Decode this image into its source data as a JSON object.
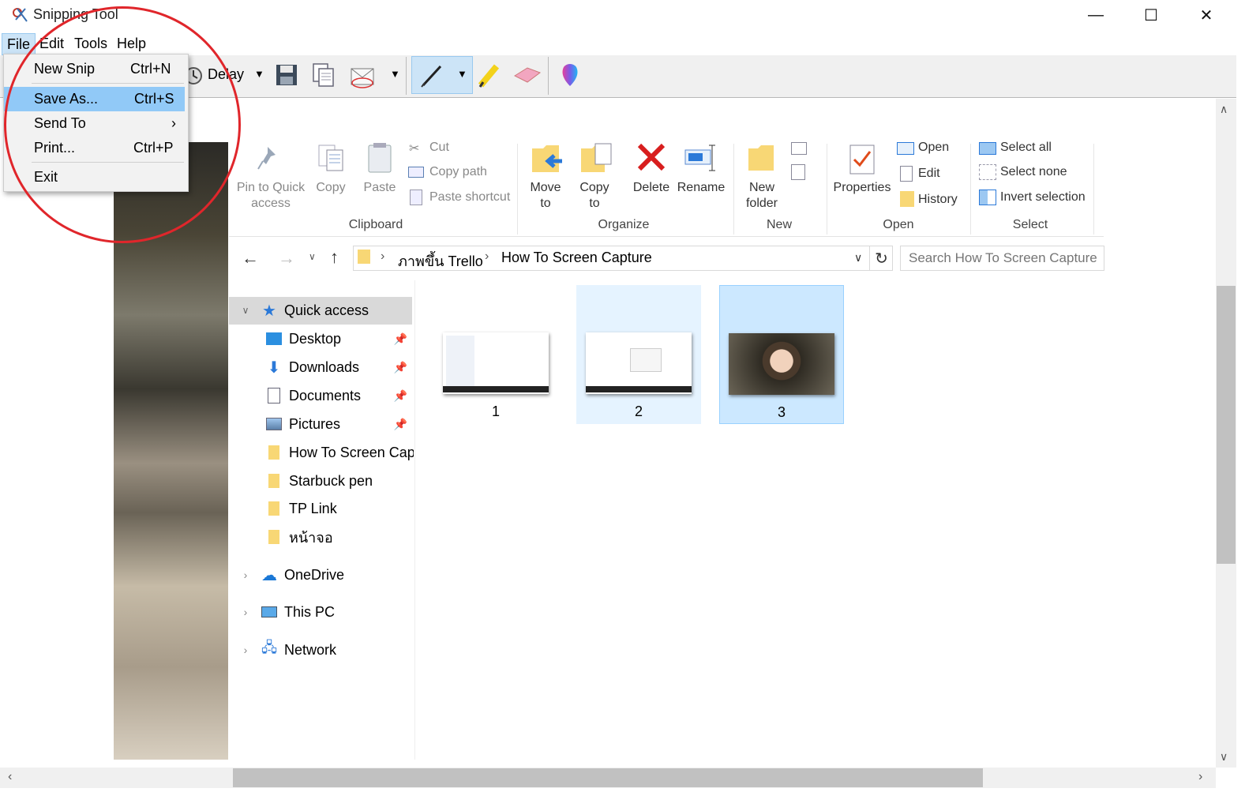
{
  "app": {
    "title": "Snipping Tool"
  },
  "window_controls": {
    "minimize": "—",
    "maximize": "☐",
    "close": "✕"
  },
  "menubar": [
    "File",
    "Edit",
    "Tools",
    "Help"
  ],
  "toolbar": {
    "delay_label": "Delay"
  },
  "file_menu": {
    "items": [
      {
        "label": "New Snip",
        "shortcut": "Ctrl+N"
      },
      {
        "label": "Save As...",
        "shortcut": "Ctrl+S",
        "highlighted": true
      },
      {
        "label": "Send To",
        "shortcut": "›"
      },
      {
        "label": "Print...",
        "shortcut": "Ctrl+P"
      },
      {
        "label": "Exit",
        "shortcut": ""
      }
    ]
  },
  "ribbon": {
    "clipboard": {
      "pin": "Pin to Quick access",
      "copy": "Copy",
      "paste": "Paste",
      "cut": "Cut",
      "copy_path": "Copy path",
      "paste_shortcut": "Paste shortcut",
      "group": "Clipboard"
    },
    "organize": {
      "move_to": "Move to",
      "copy_to": "Copy to",
      "delete": "Delete",
      "rename": "Rename",
      "group": "Organize"
    },
    "new": {
      "new_folder": "New folder",
      "group": "New"
    },
    "open": {
      "properties": "Properties",
      "open": "Open",
      "edit": "Edit",
      "history": "History",
      "group": "Open"
    },
    "select": {
      "select_all": "Select all",
      "select_none": "Select none",
      "invert": "Invert selection",
      "group": "Select"
    }
  },
  "address": {
    "crumbs": [
      "ภาพขึ้น Trello",
      "How To Screen Capture"
    ],
    "search_placeholder": "Search How To Screen Capture"
  },
  "nav": {
    "quick_access": "Quick access",
    "items": [
      {
        "label": "Desktop",
        "pinned": true,
        "icon": "desktop-icon"
      },
      {
        "label": "Downloads",
        "pinned": true,
        "icon": "download-icon"
      },
      {
        "label": "Documents",
        "pinned": true,
        "icon": "documents-icon"
      },
      {
        "label": "Pictures",
        "pinned": true,
        "icon": "pictures-icon"
      },
      {
        "label": "How To Screen Capture",
        "pinned": false,
        "icon": "folder-icon"
      },
      {
        "label": "Starbuck pen",
        "pinned": false,
        "icon": "folder-icon"
      },
      {
        "label": "TP Link",
        "pinned": false,
        "icon": "folder-icon"
      },
      {
        "label": "หน้าจอ",
        "pinned": false,
        "icon": "folder-icon"
      }
    ],
    "onedrive": "OneDrive",
    "thispc": "This PC",
    "network": "Network"
  },
  "files": [
    {
      "name": "1",
      "state": "normal"
    },
    {
      "name": "2",
      "state": "hover"
    },
    {
      "name": "3",
      "state": "selected"
    }
  ],
  "colors": {
    "accent": "#0078d7",
    "menu_highlight": "#91c9f7",
    "annotation_circle": "#e0262b",
    "selected_tile": "#cce8ff"
  }
}
